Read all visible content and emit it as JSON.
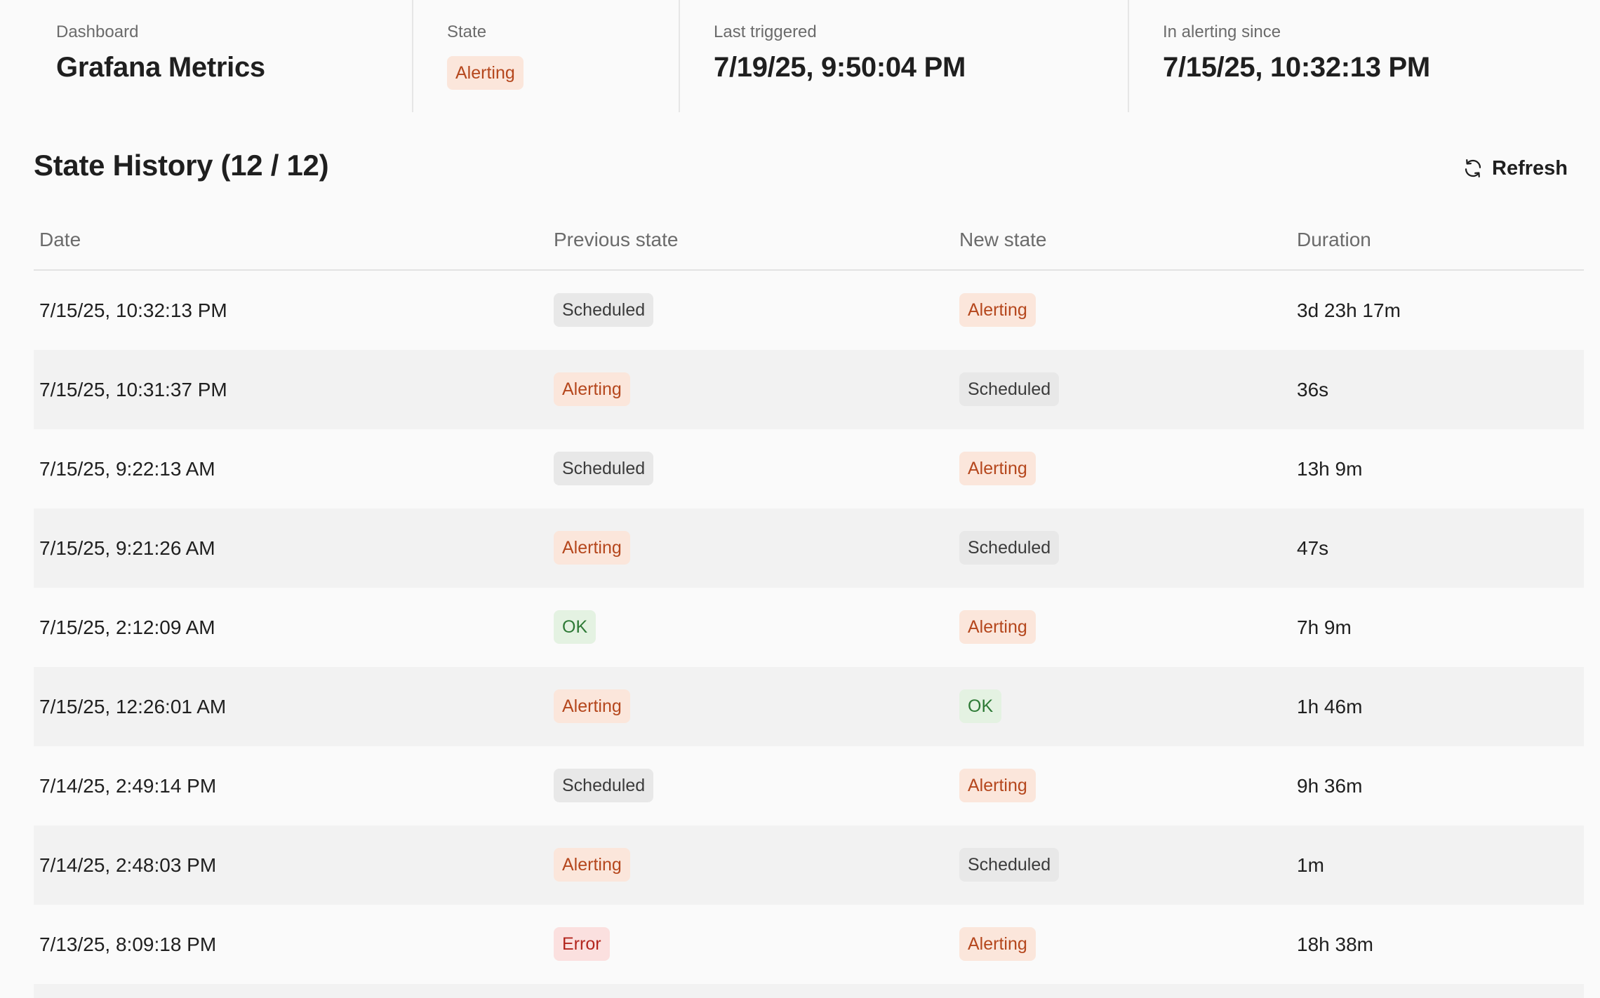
{
  "summary": {
    "dashboard_label": "Dashboard",
    "dashboard_value": "Grafana Metrics",
    "state_label": "State",
    "state_value": "Alerting",
    "last_triggered_label": "Last triggered",
    "last_triggered_value": "7/19/25, 9:50:04 PM",
    "alerting_since_label": "In alerting since",
    "alerting_since_value": "7/15/25, 10:32:13 PM"
  },
  "history": {
    "title": "State History (12 / 12)",
    "refresh_label": "Refresh",
    "refresh_icon": "refresh-icon",
    "columns": {
      "date": "Date",
      "previous": "Previous state",
      "new": "New state",
      "duration": "Duration"
    },
    "rows": [
      {
        "date": "7/15/25, 10:32:13 PM",
        "prev": "Scheduled",
        "new": "Alerting",
        "duration": "3d 23h 17m"
      },
      {
        "date": "7/15/25, 10:31:37 PM",
        "prev": "Alerting",
        "new": "Scheduled",
        "duration": "36s"
      },
      {
        "date": "7/15/25, 9:22:13 AM",
        "prev": "Scheduled",
        "new": "Alerting",
        "duration": "13h 9m"
      },
      {
        "date": "7/15/25, 9:21:26 AM",
        "prev": "Alerting",
        "new": "Scheduled",
        "duration": "47s"
      },
      {
        "date": "7/15/25, 2:12:09 AM",
        "prev": "OK",
        "new": "Alerting",
        "duration": "7h 9m"
      },
      {
        "date": "7/15/25, 12:26:01 AM",
        "prev": "Alerting",
        "new": "OK",
        "duration": "1h 46m"
      },
      {
        "date": "7/14/25, 2:49:14 PM",
        "prev": "Scheduled",
        "new": "Alerting",
        "duration": "9h 36m"
      },
      {
        "date": "7/14/25, 2:48:03 PM",
        "prev": "Alerting",
        "new": "Scheduled",
        "duration": "1m"
      },
      {
        "date": "7/13/25, 8:09:18 PM",
        "prev": "Error",
        "new": "Alerting",
        "duration": "18h 38m"
      }
    ]
  },
  "colors": {
    "alerting_bg": "#fbe6db",
    "alerting_fg": "#b5471d",
    "scheduled_bg": "#e8e8e8",
    "scheduled_fg": "#3b3b3b",
    "ok_bg": "#e4f2e2",
    "ok_fg": "#2e7a36",
    "error_bg": "#fbe0df",
    "error_fg": "#b3261e"
  }
}
